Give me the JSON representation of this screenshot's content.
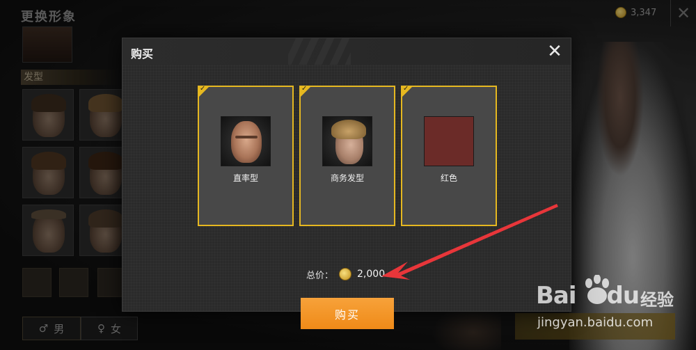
{
  "background": {
    "title": "更换形象",
    "coin_balance": "3,347",
    "close_glyph": "✕",
    "hair_section_label": "发型",
    "gender": {
      "male_symbol": "♂",
      "male_label": "男",
      "female_symbol": "♀",
      "female_label": "女"
    }
  },
  "modal": {
    "title": "购买",
    "close_glyph": "✕",
    "items": [
      {
        "label": "直率型",
        "thumb": "face-portrait"
      },
      {
        "label": "商务发型",
        "thumb": "hair-portrait"
      },
      {
        "label": "红色",
        "thumb": "color-swatch",
        "color": "#6b2b28"
      }
    ],
    "total_label": "总价：",
    "total_value": "2,000",
    "buy_label": "购买"
  },
  "annotation": {
    "arrow_color": "#e8363a"
  },
  "watermark": {
    "logo_text_1": "Bai",
    "logo_text_2": "du",
    "logo_cn": "经验",
    "url": "jingyan.baidu.com"
  }
}
